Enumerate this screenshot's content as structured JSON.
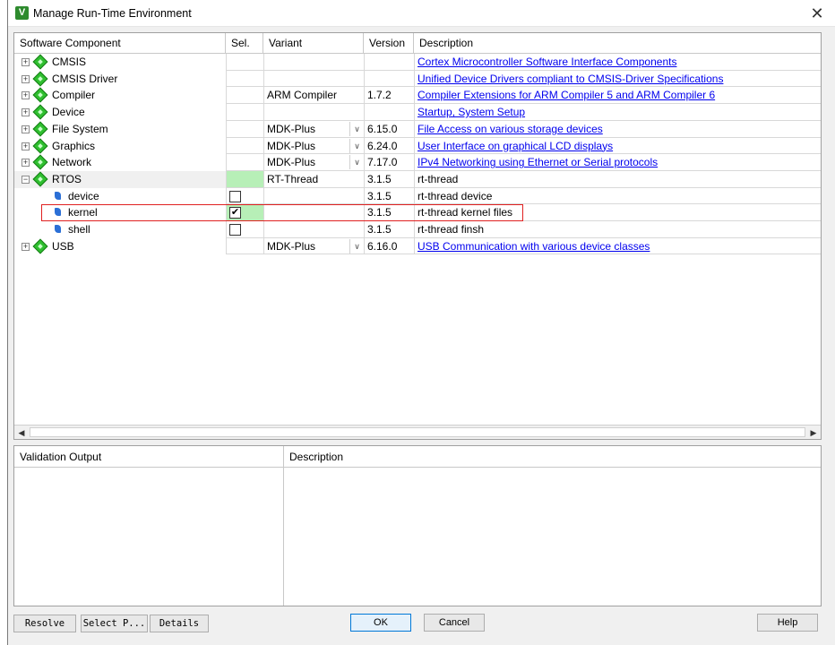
{
  "window": {
    "title": "Manage Run-Time Environment",
    "close_glyph": "✕"
  },
  "grid": {
    "headers": {
      "component": "Software Component",
      "sel": "Sel.",
      "variant": "Variant",
      "version": "Version",
      "description": "Description"
    },
    "rows": [
      {
        "name": "CMSIS",
        "variant": "",
        "version": "",
        "description": "Cortex Microcontroller Software Interface Components",
        "link": true
      },
      {
        "name": "CMSIS Driver",
        "variant": "",
        "version": "",
        "description": "Unified Device Drivers compliant to CMSIS-Driver Specifications",
        "link": true
      },
      {
        "name": "Compiler",
        "variant": "ARM Compiler",
        "version": "1.7.2",
        "description": "Compiler Extensions for ARM Compiler 5 and ARM Compiler 6",
        "link": true
      },
      {
        "name": "Device",
        "variant": "",
        "version": "",
        "description": "Startup, System Setup",
        "link": true
      },
      {
        "name": "File System",
        "variant": "MDK-Plus",
        "version": "6.15.0",
        "description": "File Access on various storage devices",
        "link": true
      },
      {
        "name": "Graphics",
        "variant": "MDK-Plus",
        "version": "6.24.0",
        "description": "User Interface on graphical LCD displays",
        "link": true
      },
      {
        "name": "Network",
        "variant": "MDK-Plus",
        "version": "7.17.0",
        "description": "IPv4 Networking using Ethernet or Serial protocols",
        "link": true
      },
      {
        "name": "RTOS",
        "variant": "RT-Thread",
        "version": "3.1.5",
        "description": "rt-thread",
        "link": false
      },
      {
        "name": "device",
        "variant": "",
        "version": "3.1.5",
        "description": "rt-thread device",
        "link": false,
        "checked": false
      },
      {
        "name": "kernel",
        "variant": "",
        "version": "3.1.5",
        "description": "rt-thread kernel files",
        "link": false,
        "checked": true
      },
      {
        "name": "shell",
        "variant": "",
        "version": "3.1.5",
        "description": "rt-thread finsh",
        "link": false,
        "checked": false
      },
      {
        "name": "USB",
        "variant": "MDK-Plus",
        "version": "6.16.0",
        "description": "USB Communication with various device classes",
        "link": true
      }
    ],
    "check_glyph": "✔",
    "expand_glyph": "+",
    "collapse_glyph": "−",
    "dropdown_glyph": "∨"
  },
  "validation": {
    "col_output": "Validation Output",
    "col_description": "Description"
  },
  "buttons": {
    "resolve": "Resolve",
    "select_packs": "Select P...",
    "details": "Details",
    "ok": "OK",
    "cancel": "Cancel",
    "help": "Help"
  },
  "colors": {
    "accent_green": "#2fbf2f",
    "selected_bg": "#b7efb7",
    "highlight_border": "#e02020",
    "link": "#0000ee"
  }
}
